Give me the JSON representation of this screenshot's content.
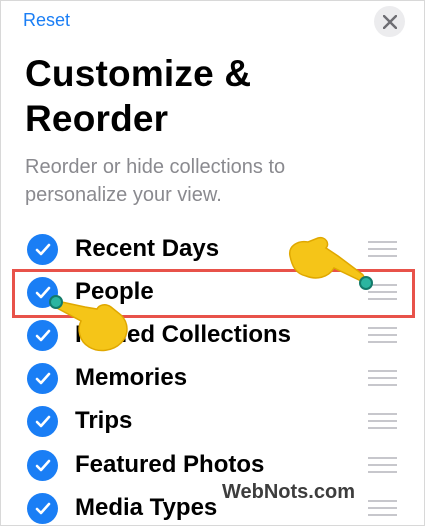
{
  "header": {
    "reset_label": "Reset",
    "close_icon": "close-icon"
  },
  "title": {
    "line1": "Customize &",
    "line2": "Reorder"
  },
  "subtitle": "Reorder or hide collections to personalize your view.",
  "rows": [
    {
      "label": "Recent Days",
      "checked": true
    },
    {
      "label": "People",
      "checked": true,
      "highlighted": true
    },
    {
      "label": "Pinned Collections",
      "checked": true
    },
    {
      "label": "Memories",
      "checked": true
    },
    {
      "label": "Trips",
      "checked": true
    },
    {
      "label": "Featured Photos",
      "checked": true
    },
    {
      "label": "Media Types",
      "checked": true
    }
  ],
  "watermark": "WebNots.com",
  "colors": {
    "accent": "#1a7ef5",
    "highlight": "#e8524a",
    "hand": "#f5c518"
  }
}
